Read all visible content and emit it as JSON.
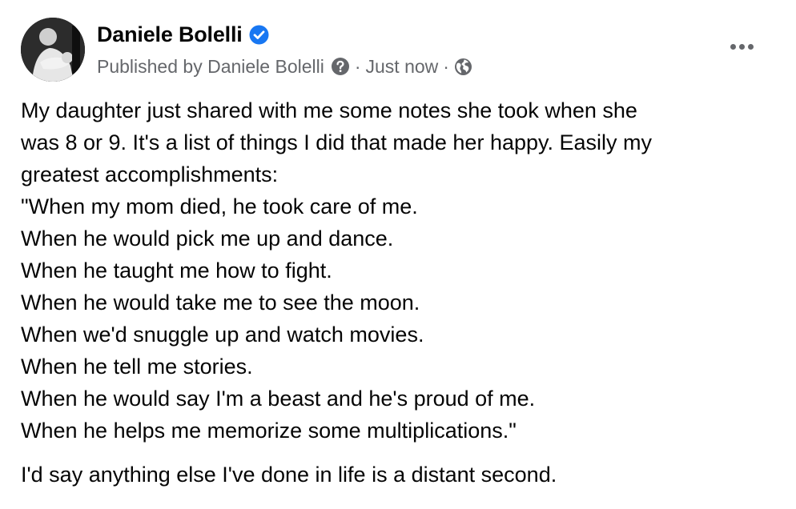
{
  "post": {
    "author_name": "Daniele Bolelli",
    "published_by": "Published by Daniele Bolelli",
    "separator": "·",
    "timestamp": "Just now",
    "body_lines": [
      "My daughter just shared with me some notes she took when she",
      "was 8 or 9. It's a list of things I did that made her happy. Easily my",
      "greatest accomplishments:",
      "\"When my mom died, he took care of me.",
      "When he would pick me up and dance.",
      "When he taught me how to fight.",
      "When he would take me to see the moon.",
      "When we'd snuggle up and watch movies.",
      "When he tell me stories.",
      "When he would say I'm a beast and he's proud of me.",
      "When he helps me memorize some multiplications.\""
    ],
    "closing": "I'd say anything else I've done in life is a distant second."
  },
  "icons": {
    "verified": "verified-badge-icon",
    "help": "question-circle-icon",
    "audience": "globe-icon",
    "more": "more-horizontal-icon"
  },
  "colors": {
    "text_primary": "#050505",
    "text_secondary": "#65676b",
    "verified_blue": "#1877f2"
  }
}
